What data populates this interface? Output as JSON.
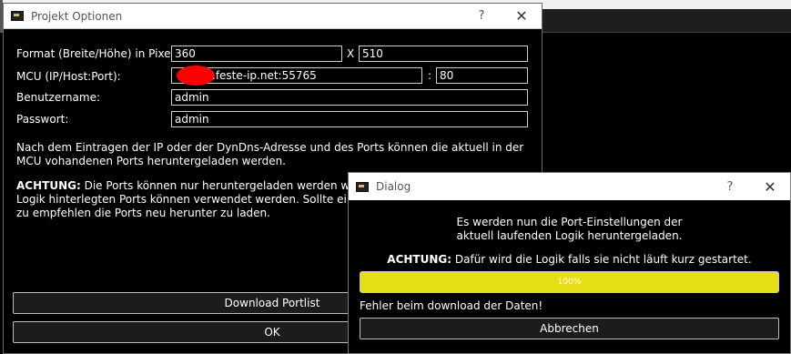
{
  "projekt_window": {
    "title": "Projekt Optionen",
    "help": "?",
    "close": "✕",
    "format_label": "Format (Breite/Höhe) in Pixel:",
    "width_value": "360",
    "size_separator": "X",
    "height_value": "510",
    "mcu_label": "MCU (IP/Host:Port):",
    "host_value": ".feste-ip.net:55765",
    "port_separator": ":",
    "port_value": "80",
    "username_label": "Benutzername:",
    "username_value": "admin",
    "password_label": "Passwort:",
    "password_value": "admin",
    "info_text": "Nach dem Eintragen der IP oder der DynDns-Adresse und des Ports können die aktuell in der MCU vohandenen Ports heruntergeladen werden.",
    "warning_bold": "ACHTUNG:",
    "warning_line1": " Die Ports können nur heruntergeladen werden wenn e",
    "warning_line2": "Logik hinterlegten Ports können verwendet werden. Sollte eine n",
    "warning_line3": "zu empfehlen die Ports neu herunter zu laden.",
    "download_button": "Download Portlist",
    "ok_button": "OK"
  },
  "dialog_window": {
    "title": "Dialog",
    "help": "?",
    "close": "✕",
    "message_line1": "Es werden nun die Port-Einstellungen der",
    "message_line2": "aktuell laufenden Logik heruntergeladen.",
    "warning_bold": "ACHTUNG:",
    "warning_text": " Dafür wird die Logik falls sie nicht läuft kurz gestartet.",
    "progress_label": "100%",
    "progress_value": 1.0,
    "error_text": "Fehler beim download der Daten!",
    "cancel_button": "Abbrechen"
  },
  "colors": {
    "progress_fill": "#e6df15",
    "redaction": "#ff0000"
  }
}
